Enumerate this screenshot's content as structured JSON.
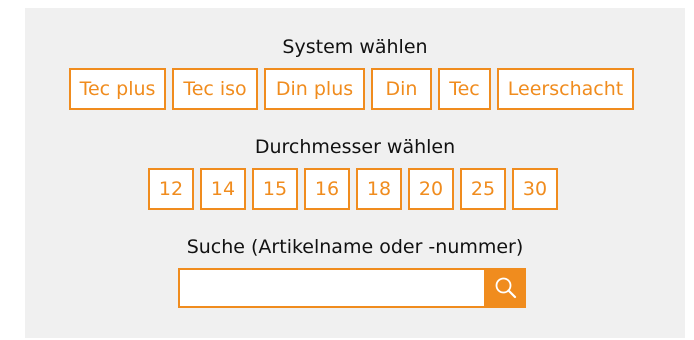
{
  "system": {
    "heading": "System wählen",
    "options": [
      "Tec plus",
      "Tec iso",
      "Din plus",
      "Din",
      "Tec",
      "Leerschacht"
    ]
  },
  "diameter": {
    "heading": "Durchmesser wählen",
    "options": [
      "12",
      "14",
      "15",
      "16",
      "18",
      "20",
      "25",
      "30"
    ]
  },
  "search": {
    "heading": "Suche (Artikelname oder -nummer)",
    "value": "",
    "icon": "search-icon"
  },
  "colors": {
    "accent": "#f08c1e",
    "panel_bg": "#f0f0f0"
  }
}
